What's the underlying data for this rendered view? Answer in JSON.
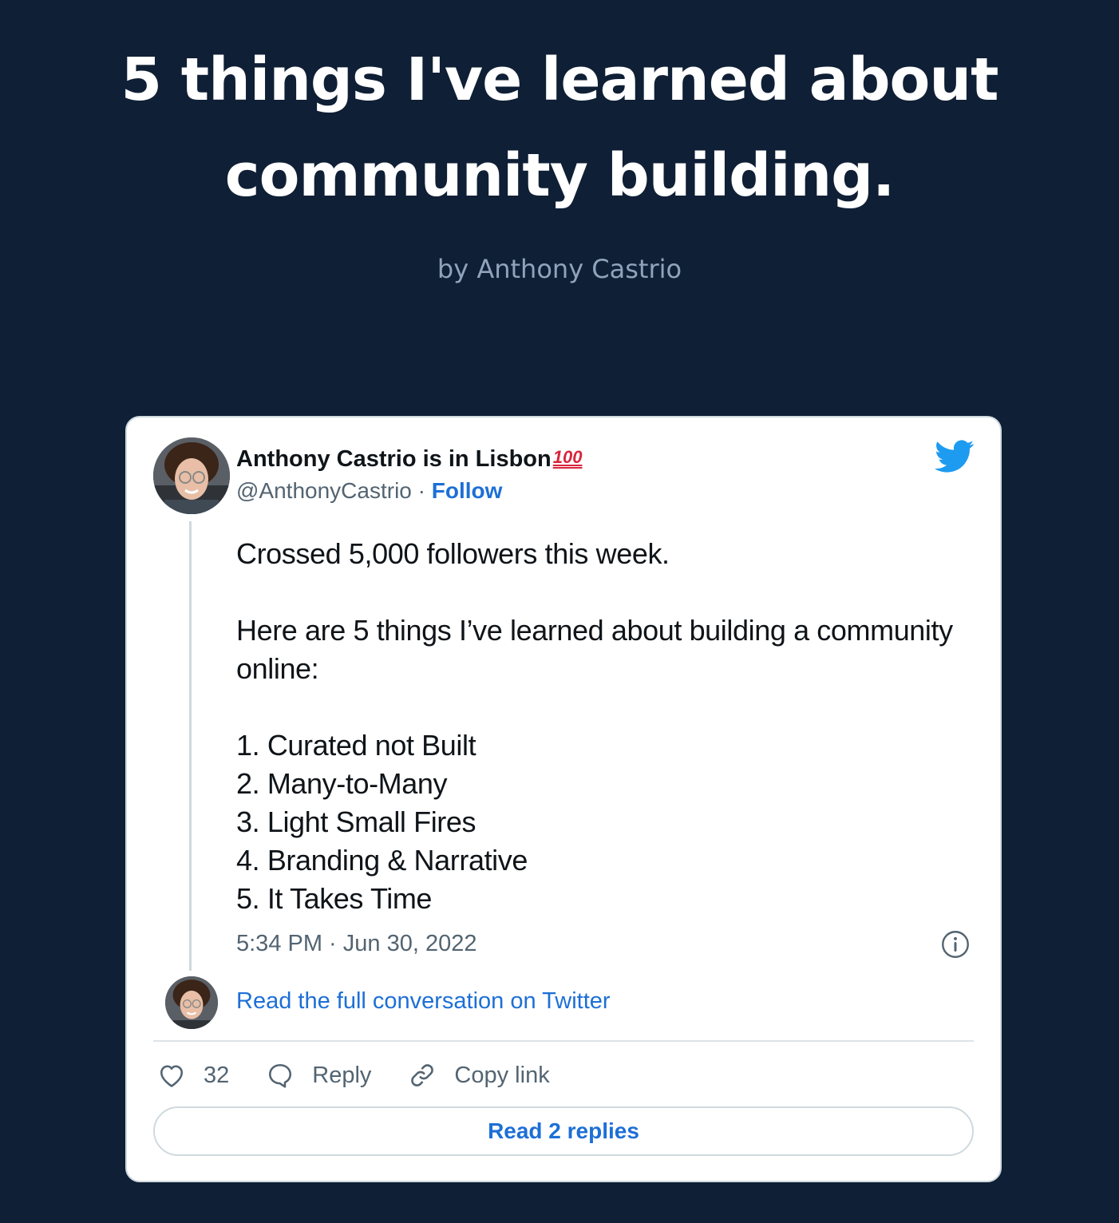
{
  "article": {
    "title": "5 things I've learned about community building.",
    "byline": "by Anthony Castrio"
  },
  "tweet": {
    "author_name": "Anthony Castrio is in Lisbon",
    "author_emoji": "100",
    "handle": "@AnthonyCastrio",
    "separator": " · ",
    "follow_label": "Follow",
    "body": {
      "line1": "Crossed 5,000 followers this week.",
      "line2": "Here are 5 things I’ve learned about building a community online:",
      "list": [
        "1. Curated not Built",
        "2. Many-to-Many",
        "3. Light Small Fires",
        "4. Branding & Narrative",
        "5. It Takes Time"
      ]
    },
    "timestamp": "5:34 PM · Jun 30, 2022",
    "full_conversation_link": "Read the full conversation on Twitter",
    "actions": {
      "like_count": "32",
      "reply_label": "Reply",
      "copy_link_label": "Copy link"
    },
    "read_replies_label": "Read 2 replies",
    "colors": {
      "link": "#1d6fd6",
      "twitter_blue": "#1d9bf0",
      "page_bg": "#0f1f35"
    },
    "icons": [
      "twitter-bird-icon",
      "info-icon",
      "heart-icon",
      "reply-bubble-icon",
      "link-icon"
    ]
  }
}
